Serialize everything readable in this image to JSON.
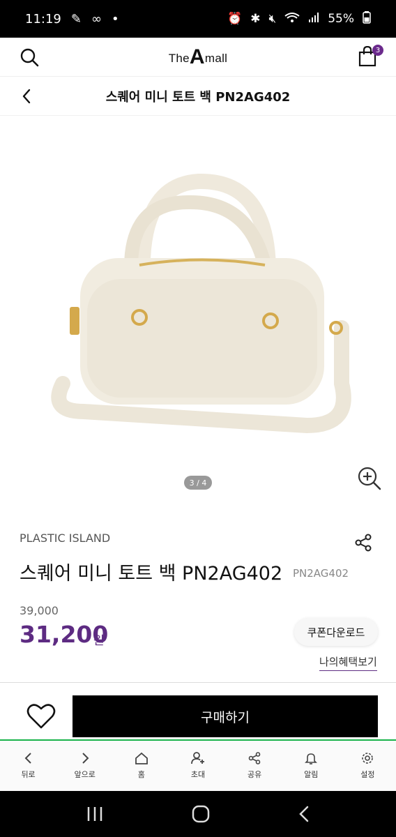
{
  "status_bar": {
    "time": "11:19",
    "battery": "55%"
  },
  "header": {
    "logo_prefix": "The",
    "logo_a": "A",
    "logo_suffix": "mall",
    "cart_count": "3",
    "accent": "#6b2a8c"
  },
  "subheader": {
    "title": "스퀘어 미니 토트 백 PN2AG402"
  },
  "gallery": {
    "page_indicator": "3 / 4"
  },
  "product": {
    "brand": "PLASTIC ISLAND",
    "title": "스퀘어 미니 토트 백 PN2AG402",
    "code": "PN2AG402",
    "original_price": "39,000",
    "sale_price": "31,200",
    "currency": "원",
    "coupon_label": "쿠폰다운로드",
    "benefit_label": "나의혜택보기",
    "price_color": "#5d2b82"
  },
  "buy_bar": {
    "buy_label": "구매하기"
  },
  "bottom_nav": {
    "items": [
      {
        "label": "뒤로",
        "icon": "chevron-left-icon"
      },
      {
        "label": "앞으로",
        "icon": "chevron-right-icon"
      },
      {
        "label": "홈",
        "icon": "home-icon"
      },
      {
        "label": "초대",
        "icon": "add-person-icon"
      },
      {
        "label": "공유",
        "icon": "share-icon"
      },
      {
        "label": "알림",
        "icon": "bell-icon"
      },
      {
        "label": "설정",
        "icon": "gear-icon"
      }
    ],
    "accent": "#19b34a"
  }
}
